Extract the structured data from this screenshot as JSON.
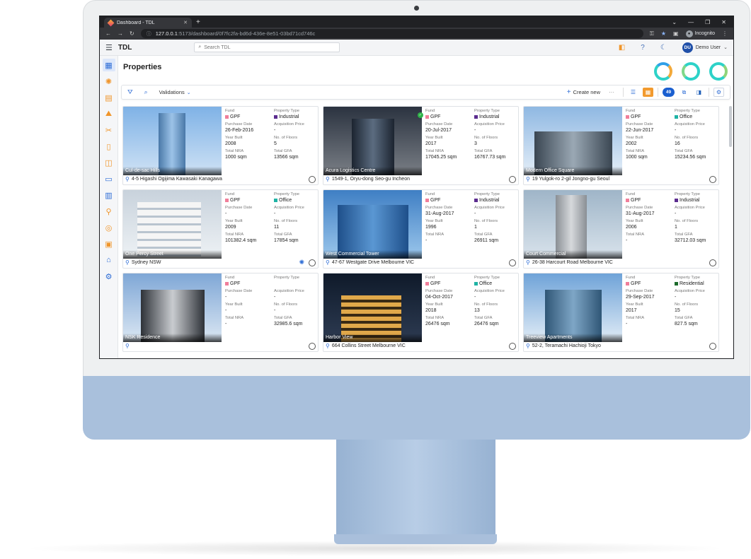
{
  "browser": {
    "tab_title": "Dashboard - TDL",
    "url_host": "127.0.0.1",
    "url_path": ":5173/dashboard/0f7fc2fa-bd6d-436e-8e51-03bd71cd746c",
    "profile": "Incognito"
  },
  "app": {
    "brand": "TDL",
    "search_placeholder": "Search TDL",
    "user_initials": "DU",
    "user_name": "Demo User"
  },
  "page": {
    "title": "Properties",
    "toolbar": {
      "validations_label": "Validations",
      "create_label": "Create new",
      "count": "49"
    }
  },
  "field_labels": {
    "fund": "Fund",
    "property_type": "Property Type",
    "purchase_date": "Purchase Date",
    "acquisition_price": "Acquisition Price",
    "year_built": "Year Built",
    "floors": "No. of Floors",
    "nra": "Total NRA",
    "gfa": "Total GFA"
  },
  "colors": {
    "accent": "#2e6dd6",
    "orange": "#f29a2e",
    "gpf": "#f07f9a",
    "industrial": "#5b2c8f",
    "office": "#1fb3a5",
    "residential": "#1d6b2c"
  },
  "properties": [
    {
      "name": "Cul-de-sac Hills",
      "fund": "GPF",
      "type": "Industrial",
      "type_color": "#5b2c8f",
      "purchase": "26-Feb-2016",
      "price": "-",
      "year": "2008",
      "floors": "5",
      "nra": "1000 sqm",
      "gfa": "13566 sqm",
      "address": "4-5 Higashi Ogijima Kawasaki Kanagawa"
    },
    {
      "name": "Acura Logistics Centre",
      "fund": "GPF",
      "type": "Industrial",
      "type_color": "#5b2c8f",
      "purchase": "20-Jul-2017",
      "price": "-",
      "year": "2017",
      "floors": "3",
      "nra": "17045.25 sqm",
      "gfa": "16767.73 sqm",
      "address": "1549-1, Oryu-dong Seo-gu Incheon"
    },
    {
      "name": "Modern Office Square",
      "fund": "GPF",
      "type": "Office",
      "type_color": "#1fb3a5",
      "purchase": "22-Jun-2017",
      "price": "-",
      "year": "2002",
      "floors": "16",
      "nra": "1000 sqm",
      "gfa": "15234.56 sqm",
      "address": "19 Yulgok-ro 2-gil Jongno-gu Seoul"
    },
    {
      "name": "One Percy Street",
      "fund": "GPF",
      "type": "Office",
      "type_color": "#1fb3a5",
      "purchase": "-",
      "price": "-",
      "year": "2009",
      "floors": "11",
      "nra": "101382.4 sqm",
      "gfa": "17854 sqm",
      "address": "Sydney NSW"
    },
    {
      "name": "West Commercial Tower",
      "fund": "GPF",
      "type": "Industrial",
      "type_color": "#5b2c8f",
      "purchase": "31-Aug-2017",
      "price": "-",
      "year": "1996",
      "floors": "1",
      "nra": "-",
      "gfa": "26911 sqm",
      "address": "47-67 Westgate Drive Melbourne VIC"
    },
    {
      "name": "Court Commercial",
      "fund": "GPF",
      "type": "Industrial",
      "type_color": "#5b2c8f",
      "purchase": "31-Aug-2017",
      "price": "-",
      "year": "2006",
      "floors": "1",
      "nra": "-",
      "gfa": "32712.03 sqm",
      "address": "26-38 Harcourt Road Melbourne VIC"
    },
    {
      "name": "NSK Residence",
      "fund": "GPF",
      "type": "",
      "type_color": "",
      "purchase": "-",
      "price": "-",
      "year": "-",
      "floors": "-",
      "nra": "-",
      "gfa": "32985.6 sqm",
      "address": ""
    },
    {
      "name": "Harbor View",
      "fund": "GPF",
      "type": "Office",
      "type_color": "#1fb3a5",
      "purchase": "04-Oct-2017",
      "price": "-",
      "year": "2018",
      "floors": "13",
      "nra": "26476 sqm",
      "gfa": "26476 sqm",
      "address": "664 Collins Street Melbourne VIC"
    },
    {
      "name": "Treeview Apartments",
      "fund": "GPF",
      "type": "Residential",
      "type_color": "#1d6b2c",
      "purchase": "29-Sep-2017",
      "price": "-",
      "year": "2017",
      "floors": "15",
      "nra": "-",
      "gfa": "827.5 sqm",
      "address": "52-2, Teramachi Hachioji Tokyo"
    }
  ]
}
